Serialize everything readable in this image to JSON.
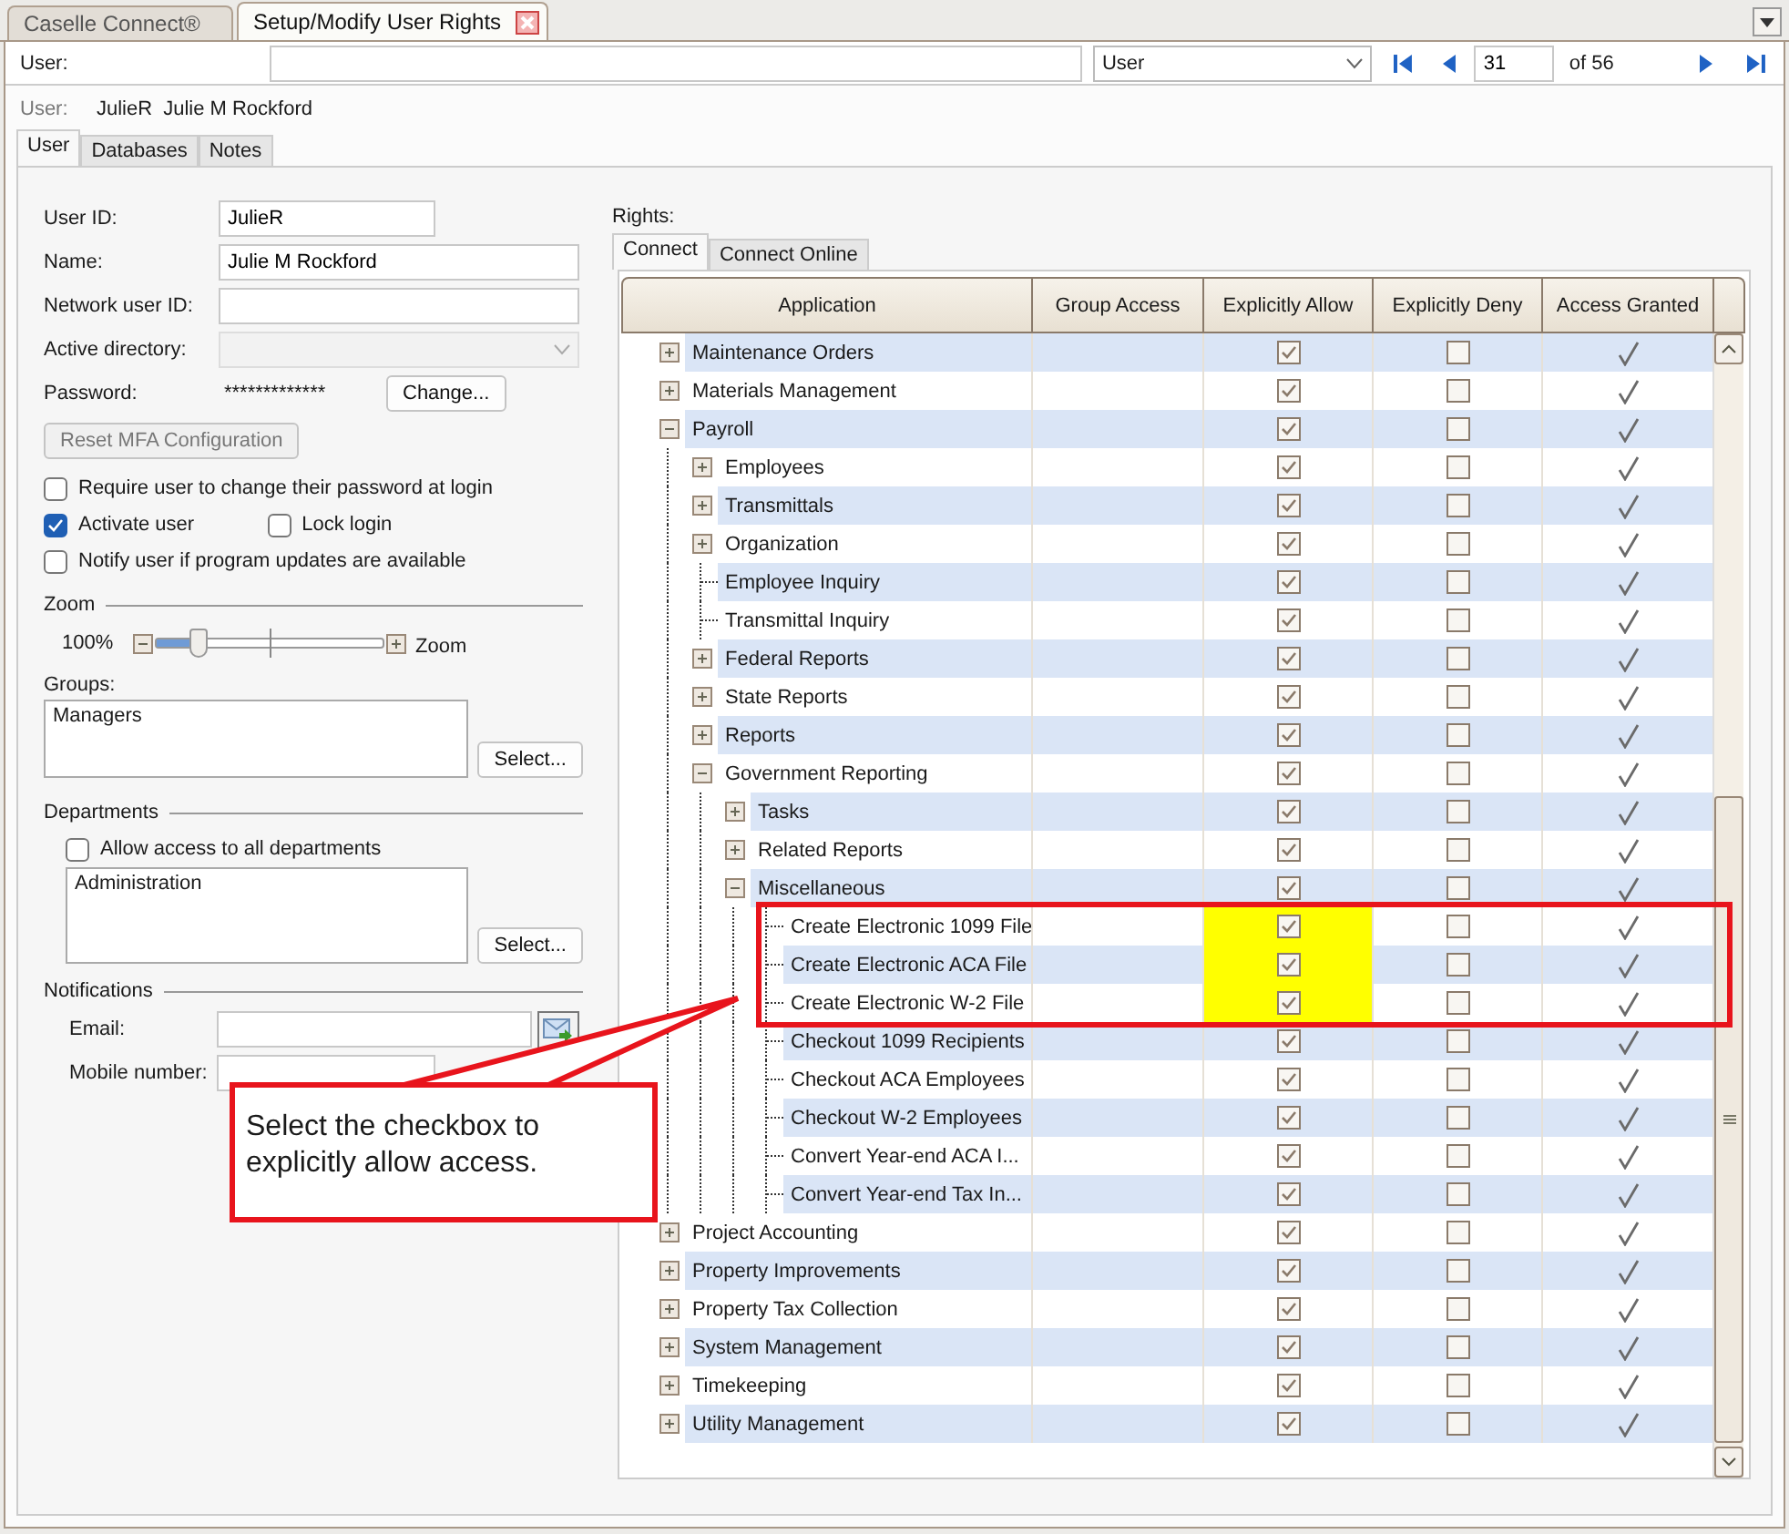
{
  "tabs": [
    {
      "label": "Caselle Connect®",
      "selected": false,
      "closable": false
    },
    {
      "label": "Setup/Modify User Rights",
      "selected": true,
      "closable": true
    }
  ],
  "user_bar": {
    "label": "User:",
    "type": "User",
    "record": "31",
    "total": "of 56"
  },
  "current_user": {
    "label": "User:",
    "id": "JulieR",
    "name": "Julie M Rockford"
  },
  "sub_tabs": [
    {
      "label": "User",
      "selected": true
    },
    {
      "label": "Databases",
      "selected": false
    },
    {
      "label": "Notes",
      "selected": false
    }
  ],
  "fields": [
    {
      "kind": "short",
      "label": "User ID:",
      "value": "JulieR",
      "disabled": false
    },
    {
      "kind": "text",
      "label": "Name:",
      "value": "Julie M Rockford",
      "disabled": false
    },
    {
      "kind": "text",
      "label": "Network user ID:",
      "disabled": false
    },
    {
      "kind": "select",
      "label": "Active directory:",
      "disabled": true
    },
    {
      "kind": "password",
      "label": "Password:",
      "value": "*************",
      "button": "Change...",
      "disabled": false
    }
  ],
  "reset_button": {
    "label": "Reset MFA Configuration",
    "disabled": true
  },
  "options": [
    [
      {
        "label": "Require user to change their password at login",
        "checked": false
      }
    ],
    [
      {
        "label": "Activate user",
        "checked": true
      },
      {
        "label": "Lock login",
        "checked": false
      }
    ],
    [
      {
        "label": "Notify user if program updates are available",
        "checked": false
      }
    ]
  ],
  "zoom": {
    "title": "Zoom",
    "reading": "100%",
    "label": "Zoom",
    "level": 0.16
  },
  "groups": {
    "label": "Groups:",
    "items": [
      "Managers"
    ],
    "button": "Select..."
  },
  "departments": {
    "title": "Departments",
    "all": {
      "label": "Allow access to all departments",
      "checked": false
    },
    "items": [
      "Administration"
    ],
    "button": "Select..."
  },
  "notifications": {
    "title": "Notifications",
    "email": {
      "label": "Email:"
    },
    "mobile": {
      "label": "Mobile number:"
    }
  },
  "rights": {
    "label": "Rights:",
    "tabs": [
      {
        "label": "Connect",
        "selected": true
      },
      {
        "label": "Connect Online",
        "selected": false
      }
    ],
    "columns": [
      "Application",
      "Group Access",
      "Explicitly Allow",
      "Explicitly Deny",
      "Access Granted"
    ],
    "rows": [
      {
        "label": "Maintenance Orders",
        "expanded": false,
        "allow": true,
        "deny": false,
        "granted": true,
        "highlighted": false
      },
      {
        "label": "Materials Management",
        "expanded": false,
        "allow": true,
        "deny": false,
        "granted": true,
        "highlighted": false
      },
      {
        "label": "Payroll",
        "expanded": true,
        "allow": true,
        "deny": false,
        "granted": true,
        "highlighted": false,
        "children": [
          {
            "label": "Employees",
            "expanded": false,
            "allow": true,
            "deny": false,
            "granted": true,
            "highlighted": false
          },
          {
            "label": "Transmittals",
            "expanded": false,
            "allow": true,
            "deny": false,
            "granted": true,
            "highlighted": false
          },
          {
            "label": "Organization",
            "expanded": false,
            "allow": true,
            "deny": false,
            "granted": true,
            "highlighted": false
          },
          {
            "label": "Employee Inquiry",
            "allow": true,
            "deny": false,
            "granted": true,
            "highlighted": false
          },
          {
            "label": "Transmittal Inquiry",
            "allow": true,
            "deny": false,
            "granted": true,
            "highlighted": false
          },
          {
            "label": "Federal Reports",
            "expanded": false,
            "allow": true,
            "deny": false,
            "granted": true,
            "highlighted": false
          },
          {
            "label": "State Reports",
            "expanded": false,
            "allow": true,
            "deny": false,
            "granted": true,
            "highlighted": false
          },
          {
            "label": "Reports",
            "expanded": false,
            "allow": true,
            "deny": false,
            "granted": true,
            "highlighted": false
          },
          {
            "label": "Government Reporting",
            "expanded": true,
            "allow": true,
            "deny": false,
            "granted": true,
            "highlighted": false,
            "children": [
              {
                "label": "Tasks",
                "expanded": false,
                "allow": true,
                "deny": false,
                "granted": true,
                "highlighted": false
              },
              {
                "label": "Related Reports",
                "expanded": false,
                "allow": true,
                "deny": false,
                "granted": true,
                "highlighted": false
              },
              {
                "label": "Miscellaneous",
                "expanded": true,
                "allow": true,
                "deny": false,
                "granted": true,
                "highlighted": false,
                "children": [
                  {
                    "label": "Create Electronic 1099 File",
                    "allow": true,
                    "deny": false,
                    "granted": true,
                    "highlighted": true
                  },
                  {
                    "label": "Create Electronic ACA File",
                    "allow": true,
                    "deny": false,
                    "granted": true,
                    "highlighted": true
                  },
                  {
                    "label": "Create Electronic W-2 File",
                    "allow": true,
                    "deny": false,
                    "granted": true,
                    "highlighted": true
                  },
                  {
                    "label": "Checkout 1099 Recipients",
                    "allow": true,
                    "deny": false,
                    "granted": true,
                    "highlighted": false
                  },
                  {
                    "label": "Checkout ACA Employees",
                    "allow": true,
                    "deny": false,
                    "granted": true,
                    "highlighted": false
                  },
                  {
                    "label": "Checkout W-2 Employees",
                    "allow": true,
                    "deny": false,
                    "granted": true,
                    "highlighted": false
                  },
                  {
                    "label": "Convert Year-end ACA I...",
                    "allow": true,
                    "deny": false,
                    "granted": true,
                    "highlighted": false
                  },
                  {
                    "label": "Convert Year-end Tax In...",
                    "allow": true,
                    "deny": false,
                    "granted": true,
                    "highlighted": false
                  }
                ]
              }
            ]
          }
        ]
      },
      {
        "label": "Project Accounting",
        "expanded": false,
        "allow": true,
        "deny": false,
        "granted": true,
        "highlighted": false
      },
      {
        "label": "Property Improvements",
        "expanded": false,
        "allow": true,
        "deny": false,
        "granted": true,
        "highlighted": false
      },
      {
        "label": "Property Tax Collection",
        "expanded": false,
        "allow": true,
        "deny": false,
        "granted": true,
        "highlighted": false
      },
      {
        "label": "System Management",
        "expanded": false,
        "allow": true,
        "deny": false,
        "granted": true,
        "highlighted": false
      },
      {
        "label": "Timekeeping",
        "expanded": false,
        "allow": true,
        "deny": false,
        "granted": true,
        "highlighted": false
      },
      {
        "label": "Utility Management",
        "expanded": false,
        "allow": true,
        "deny": false,
        "granted": true,
        "highlighted": false
      }
    ]
  },
  "callout": {
    "text": "Select the checkbox to explicitly allow access."
  }
}
